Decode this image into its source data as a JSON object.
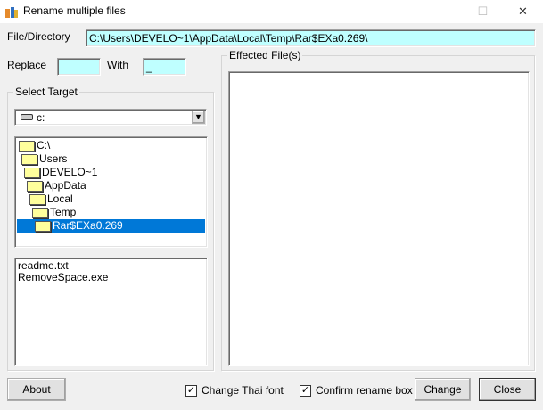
{
  "window": {
    "title": "Rename multiple files",
    "minimize": "—",
    "maximize": "☐",
    "close": "✕"
  },
  "path": {
    "label": "File/Directory",
    "value": "C:\\Users\\DEVELO~1\\AppData\\Local\\Temp\\Rar$EXa0.269\\"
  },
  "replace": {
    "label": "Replace",
    "value": "",
    "with_label": "With",
    "with_value": "_"
  },
  "select_target": {
    "label": "Select Target",
    "drive": "c:",
    "folders": [
      {
        "name": "C:\\"
      },
      {
        "name": "Users"
      },
      {
        "name": "DEVELO~1"
      },
      {
        "name": "AppData"
      },
      {
        "name": "Local"
      },
      {
        "name": "Temp"
      },
      {
        "name": "Rar$EXa0.269",
        "selected": true
      }
    ],
    "files": [
      "readme.txt",
      "RemoveSpace.exe"
    ]
  },
  "effected": {
    "label": "Effected File(s)"
  },
  "footer": {
    "about": "About",
    "change_thai_font": "Change Thai font",
    "confirm_rename": "Confirm rename box",
    "change": "Change",
    "close": "Close",
    "check": "✓"
  },
  "colors": {
    "input_bg": "#bfffff",
    "selection": "#0078d7"
  }
}
